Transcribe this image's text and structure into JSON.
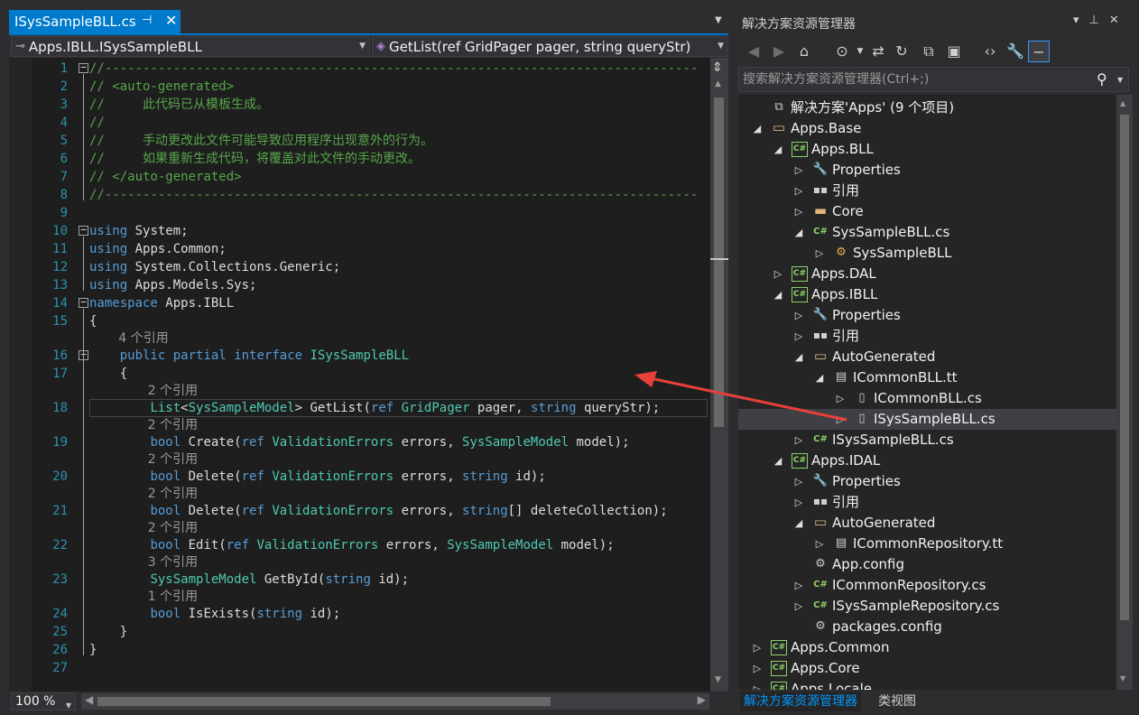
{
  "editor": {
    "tab": {
      "label": "ISysSampleBLL.cs",
      "pin_glyph": "⊣",
      "close_glyph": "✕"
    },
    "nav": {
      "type": "Apps.IBLL.ISysSampleBLL",
      "member": "GetList(ref GridPager pager, string queryStr)"
    },
    "zoom": "100 %",
    "lines": [
      {
        "n": "1",
        "fold": "−",
        "html": "<span class=\"cm\">//------------------------------------------------------------------------------</span>"
      },
      {
        "n": "2",
        "html": "<span class=\"cm\">// &lt;auto-generated&gt;</span>"
      },
      {
        "n": "3",
        "html": "<span class=\"cm\">//     此代码已从模板生成。</span>"
      },
      {
        "n": "4",
        "html": "<span class=\"cm\">//</span>"
      },
      {
        "n": "5",
        "html": "<span class=\"cm\">//     手动更改此文件可能导致应用程序出现意外的行为。</span>"
      },
      {
        "n": "6",
        "html": "<span class=\"cm\">//     如果重新生成代码，将覆盖对此文件的手动更改。</span>"
      },
      {
        "n": "7",
        "html": "<span class=\"cm\">// &lt;/auto-generated&gt;</span>"
      },
      {
        "n": "8",
        "html": "<span class=\"cm\">//------------------------------------------------------------------------------</span>"
      },
      {
        "n": "9",
        "html": ""
      },
      {
        "n": "10",
        "fold": "−",
        "html": "<span class=\"kw\">using</span> System;"
      },
      {
        "n": "11",
        "html": "<span class=\"kw\">using</span> Apps.Common;"
      },
      {
        "n": "12",
        "html": "<span class=\"kw\">using</span> System.Collections.Generic;"
      },
      {
        "n": "13",
        "html": "<span class=\"kw\">using</span> Apps.Models.Sys;"
      },
      {
        "n": "14",
        "fold": "−",
        "html": "<span class=\"kw\">namespace</span> Apps.IBLL"
      },
      {
        "n": "15",
        "html": "{"
      },
      {
        "lens": "4 个引用",
        "indent": 4
      },
      {
        "n": "16",
        "fold": "−",
        "html": "    <span class=\"kw\">public</span> <span class=\"kw\">partial</span> <span class=\"kw\">interface</span> <span class=\"ty\">ISysSampleBLL</span>"
      },
      {
        "n": "17",
        "html": "    {"
      },
      {
        "lens": "2 个引用",
        "indent": 8
      },
      {
        "n": "18",
        "html": "        <span class=\"ty\">List</span>&lt;<span class=\"ty\">SysSampleModel</span>&gt; GetList(<span class=\"kw\">ref</span> <span class=\"ty\">GridPager</span> pager, <span class=\"kw\">string</span> queryStr);"
      },
      {
        "lens": "2 个引用",
        "indent": 8
      },
      {
        "n": "19",
        "html": "        <span class=\"kw\">bool</span> Create(<span class=\"kw\">ref</span> <span class=\"ty\">ValidationErrors</span> errors, <span class=\"ty\">SysSampleModel</span> model);"
      },
      {
        "lens": "2 个引用",
        "indent": 8
      },
      {
        "n": "20",
        "html": "        <span class=\"kw\">bool</span> Delete(<span class=\"kw\">ref</span> <span class=\"ty\">ValidationErrors</span> errors, <span class=\"kw\">string</span> id);"
      },
      {
        "lens": "2 个引用",
        "indent": 8
      },
      {
        "n": "21",
        "html": "        <span class=\"kw\">bool</span> Delete(<span class=\"kw\">ref</span> <span class=\"ty\">ValidationErrors</span> errors, <span class=\"kw\">string</span>[] deleteCollection);"
      },
      {
        "lens": "2 个引用",
        "indent": 8
      },
      {
        "n": "22",
        "html": "        <span class=\"kw\">bool</span> Edit(<span class=\"kw\">ref</span> <span class=\"ty\">ValidationErrors</span> errors, <span class=\"ty\">SysSampleModel</span> model);"
      },
      {
        "lens": "3 个引用",
        "indent": 8
      },
      {
        "n": "23",
        "html": "        <span class=\"ty\">SysSampleModel</span> GetById(<span class=\"kw\">string</span> id);"
      },
      {
        "lens": "1 个引用",
        "indent": 8
      },
      {
        "n": "24",
        "html": "        <span class=\"kw\">bool</span> IsExists(<span class=\"kw\">string</span> id);"
      },
      {
        "n": "25",
        "html": "    }"
      },
      {
        "n": "26",
        "html": "}"
      },
      {
        "n": "27",
        "html": ""
      }
    ]
  },
  "solution_explorer": {
    "title": "解决方案资源管理器",
    "search_placeholder": "搜索解决方案资源管理器(Ctrl+;)",
    "tabs": [
      "解决方案资源管理器",
      "类视图"
    ],
    "nodes": [
      {
        "level": 0,
        "twisty": "",
        "icon": "sln",
        "glyph": "⧉",
        "label": "解决方案'Apps' (9 个项目)"
      },
      {
        "level": 0,
        "twisty": "◢",
        "icon": "folder",
        "glyph": "▭",
        "label": "Apps.Base"
      },
      {
        "level": 1,
        "twisty": "◢",
        "icon": "proj",
        "glyph": "C#",
        "label": "Apps.BLL"
      },
      {
        "level": 2,
        "twisty": "▷",
        "icon": "wrench",
        "glyph": "🔧",
        "label": "Properties"
      },
      {
        "level": 2,
        "twisty": "▷",
        "icon": "ref",
        "glyph": "▪▪",
        "label": "引用"
      },
      {
        "level": 2,
        "twisty": "▷",
        "icon": "folder",
        "glyph": "▬",
        "label": "Core"
      },
      {
        "level": 2,
        "twisty": "◢",
        "icon": "cs",
        "glyph": "C#",
        "label": "SysSampleBLL.cs"
      },
      {
        "level": 3,
        "twisty": "▷",
        "icon": "cls",
        "glyph": "⚙",
        "label": "SysSampleBLL"
      },
      {
        "level": 1,
        "twisty": "▷",
        "icon": "proj",
        "glyph": "C#",
        "label": "Apps.DAL"
      },
      {
        "level": 1,
        "twisty": "◢",
        "icon": "proj",
        "glyph": "C#",
        "label": "Apps.IBLL"
      },
      {
        "level": 2,
        "twisty": "▷",
        "icon": "wrench",
        "glyph": "🔧",
        "label": "Properties"
      },
      {
        "level": 2,
        "twisty": "▷",
        "icon": "ref",
        "glyph": "▪▪",
        "label": "引用"
      },
      {
        "level": 2,
        "twisty": "◢",
        "icon": "folder",
        "glyph": "▭",
        "label": "AutoGenerated"
      },
      {
        "level": 3,
        "twisty": "◢",
        "icon": "file",
        "glyph": "▤",
        "label": "ICommonBLL.tt"
      },
      {
        "level": 4,
        "twisty": "▷",
        "icon": "file",
        "glyph": "▯",
        "label": "ICommonBLL.cs"
      },
      {
        "level": 4,
        "twisty": "▷",
        "icon": "file",
        "glyph": "▯",
        "label": "ISysSampleBLL.cs",
        "selected": true
      },
      {
        "level": 2,
        "twisty": "▷",
        "icon": "cs",
        "glyph": "C#",
        "label": "ISysSampleBLL.cs"
      },
      {
        "level": 1,
        "twisty": "◢",
        "icon": "proj",
        "glyph": "C#",
        "label": "Apps.IDAL"
      },
      {
        "level": 2,
        "twisty": "▷",
        "icon": "wrench",
        "glyph": "🔧",
        "label": "Properties"
      },
      {
        "level": 2,
        "twisty": "▷",
        "icon": "ref",
        "glyph": "▪▪",
        "label": "引用"
      },
      {
        "level": 2,
        "twisty": "◢",
        "icon": "folder",
        "glyph": "▭",
        "label": "AutoGenerated"
      },
      {
        "level": 3,
        "twisty": "▷",
        "icon": "file",
        "glyph": "▤",
        "label": "ICommonRepository.tt"
      },
      {
        "level": 2,
        "twisty": "",
        "icon": "cfg",
        "glyph": "⚙",
        "label": "App.config"
      },
      {
        "level": 2,
        "twisty": "▷",
        "icon": "cs",
        "glyph": "C#",
        "label": "ICommonRepository.cs"
      },
      {
        "level": 2,
        "twisty": "▷",
        "icon": "cs",
        "glyph": "C#",
        "label": "ISysSampleRepository.cs"
      },
      {
        "level": 2,
        "twisty": "",
        "icon": "cfg",
        "glyph": "⚙",
        "label": "packages.config"
      },
      {
        "level": 0,
        "twisty": "▷",
        "icon": "proj",
        "glyph": "C#",
        "label": "Apps.Common"
      },
      {
        "level": 0,
        "twisty": "▷",
        "icon": "proj",
        "glyph": "C#",
        "label": "Apps.Core"
      },
      {
        "level": 0,
        "twisty": "▷",
        "icon": "proj",
        "glyph": "C#",
        "label": "Apps.Locale"
      }
    ]
  },
  "colors": {
    "accent": "#007acc",
    "annotation_arrow": "#e8403a"
  }
}
